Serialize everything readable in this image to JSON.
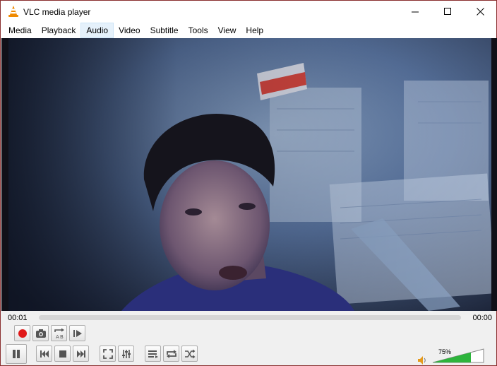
{
  "window": {
    "title": "VLC media player"
  },
  "menu": {
    "items": [
      {
        "label": "Media"
      },
      {
        "label": "Playback"
      },
      {
        "label": "Audio"
      },
      {
        "label": "Video"
      },
      {
        "label": "Subtitle"
      },
      {
        "label": "Tools"
      },
      {
        "label": "View"
      },
      {
        "label": "Help"
      }
    ],
    "active_index": 2
  },
  "player": {
    "elapsed": "00:01",
    "total": "00:00",
    "progress_fraction": 0,
    "volume_label": "75%",
    "volume_fraction": 0.75
  },
  "colors": {
    "accent_record": "#e01818",
    "volume_green": "#2db43c",
    "menu_highlight": "#e5f1fb"
  },
  "icons": {
    "record": "record-icon",
    "snapshot": "camera-icon",
    "loop_ab": "loop-ab-icon",
    "frame_step": "frame-step-icon",
    "pause": "pause-icon",
    "previous": "skip-previous-icon",
    "stop": "stop-icon",
    "next": "skip-next-icon",
    "fullscreen": "fullscreen-icon",
    "extended": "equalizer-icon",
    "playlist": "playlist-icon",
    "loop": "loop-icon",
    "shuffle": "shuffle-icon",
    "volume": "speaker-icon"
  }
}
